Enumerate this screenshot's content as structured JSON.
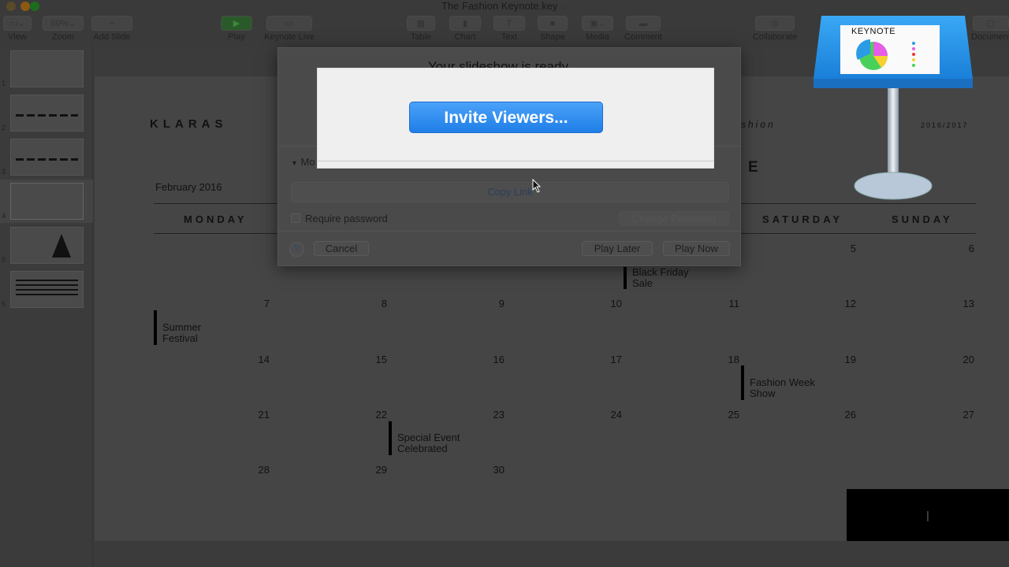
{
  "window": {
    "title": "The Fashion Keynote.key",
    "title_chevron": "⌄",
    "light_colors": [
      "#8a5a12",
      "#8a5a12",
      "#1d6b1d"
    ]
  },
  "toolbar": {
    "items": [
      {
        "label": "View",
        "glyph": "▭⌄"
      },
      {
        "label": "Zoom",
        "glyph": "60%⌄"
      },
      {
        "label": "Add Slide",
        "glyph": "+"
      },
      {
        "label": "Play",
        "glyph": "▶"
      },
      {
        "label": "Keynote Live",
        "glyph": "▭"
      },
      {
        "label": "Table",
        "glyph": "▦"
      },
      {
        "label": "Chart",
        "glyph": "▮"
      },
      {
        "label": "Text",
        "glyph": "T"
      },
      {
        "label": "Shape",
        "glyph": "■"
      },
      {
        "label": "Media",
        "glyph": "▣⌄"
      },
      {
        "label": "Comment",
        "glyph": "▬"
      },
      {
        "label": "Collaborate",
        "glyph": "◎"
      },
      {
        "label": "Document",
        "glyph": "▢"
      }
    ]
  },
  "sidebar": {
    "slides": [
      "1",
      "2",
      "3",
      "4",
      "5",
      "6"
    ],
    "selected": "4"
  },
  "slide": {
    "brand": "KLARAS",
    "subtitle": "shion",
    "season": "2016/2017",
    "heading_partial": "E",
    "month": "February 2016",
    "days": [
      "MONDAY",
      "SATURDAY",
      "SUNDAY"
    ],
    "numbers": {
      "row1": [
        "5",
        "6"
      ],
      "row2": [
        "7",
        "8",
        "9",
        "10",
        "11",
        "12",
        "13"
      ],
      "row3": [
        "14",
        "15",
        "16",
        "17",
        "18",
        "19",
        "20"
      ],
      "row4": [
        "21",
        "22",
        "23",
        "24",
        "25",
        "26",
        "27"
      ],
      "row5": [
        "28",
        "29",
        "30"
      ]
    },
    "events": [
      {
        "l1": "Black Friday",
        "l2": "Sale"
      },
      {
        "l1": "Summer",
        "l2": "Festival"
      },
      {
        "l1": "Fashion Week",
        "l2": "Show"
      },
      {
        "l1": "Special Event",
        "l2": "Celebrated"
      }
    ],
    "cursor_glyph": "|"
  },
  "dialog": {
    "heading_garbled": "Your slideshow is ready",
    "more_label": "Mo",
    "copy_link": "Copy Link",
    "require_password": "Require password",
    "change_password": "Change Password",
    "help": "?",
    "cancel": "Cancel",
    "play_later": "Play Later",
    "play_now": "Play Now"
  },
  "overlay": {
    "invite_button": "Invite Viewers...",
    "accent": "#2a88f0"
  },
  "keynote_icon": {
    "label": "KEYNOTE"
  }
}
